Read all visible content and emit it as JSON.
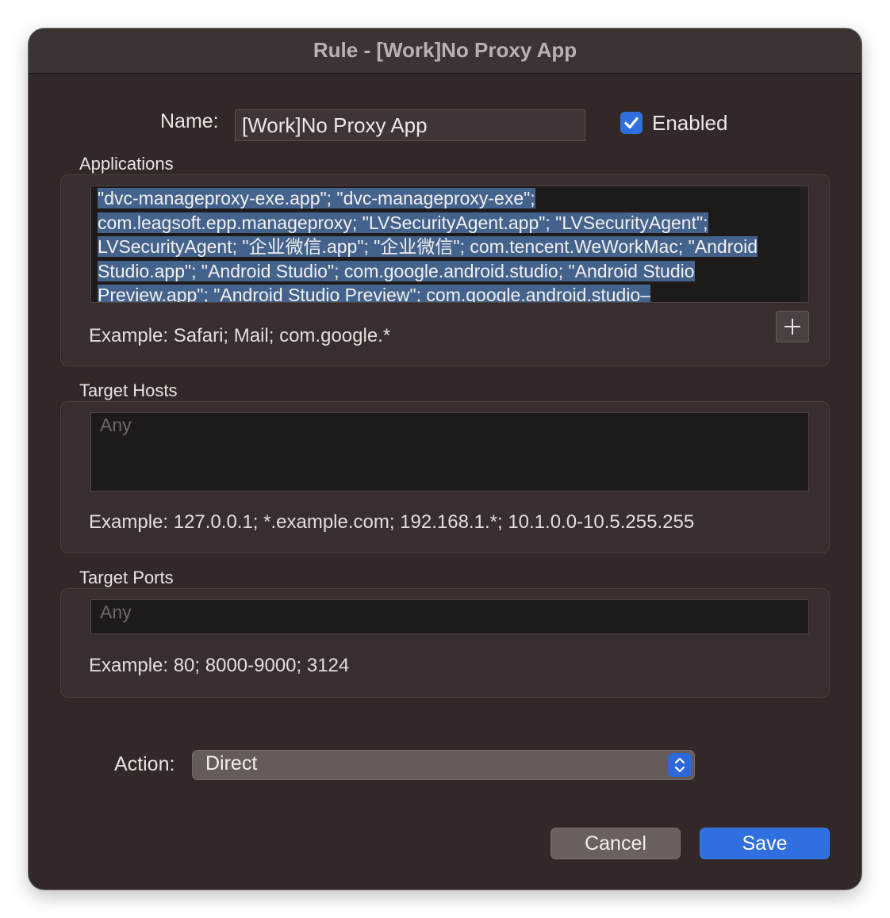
{
  "window": {
    "title": "Rule - [Work]No Proxy App"
  },
  "name": {
    "label": "Name:",
    "value": "[Work]No Proxy App"
  },
  "enabled": {
    "label": "Enabled",
    "checked": true
  },
  "applications": {
    "label": "Applications",
    "value": "\"dvc-manageproxy-exe.app\"; \"dvc-manageproxy-exe\"; com.leagsoft.epp.manageproxy; \"LVSecurityAgent.app\"; \"LVSecurityAgent\"; LVSecurityAgent; \"企业微信.app\"; \"企业微信\"; com.tencent.WeWorkMac; \"Android Studio.app\"; \"Android Studio\"; com.google.android.studio; \"Android Studio Preview.app\"; \"Android Studio Preview\"; com.google.android.studio–",
    "example": "Example: Safari; Mail; com.google.*",
    "add_icon": "plus-icon"
  },
  "target_hosts": {
    "label": "Target Hosts",
    "placeholder": "Any",
    "example": "Example: 127.0.0.1; *.example.com; 192.168.1.*; 10.1.0.0-10.5.255.255"
  },
  "target_ports": {
    "label": "Target Ports",
    "placeholder": "Any",
    "example": "Example: 80; 8000-9000; 3124"
  },
  "action": {
    "label": "Action:",
    "value": "Direct",
    "stepper_icon": "chevron-up-down-icon"
  },
  "buttons": {
    "cancel": "Cancel",
    "save": "Save"
  },
  "colors": {
    "accent": "#2f6fe0",
    "selection": "#44638c",
    "background": "#322827"
  }
}
